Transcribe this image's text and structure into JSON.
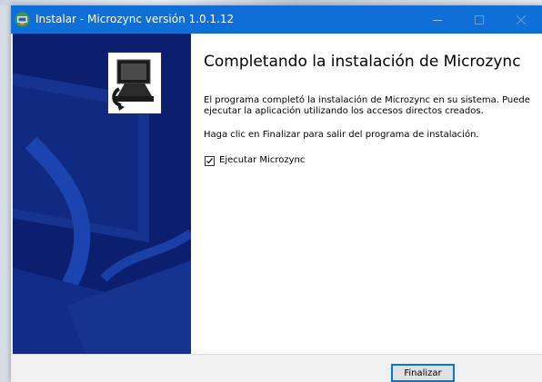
{
  "window": {
    "title": "Instalar - Microzync versión 1.0.1.12"
  },
  "titlebar": {
    "icons": [
      "installer-app-icon",
      "minimize-icon",
      "maximize-icon",
      "close-icon"
    ]
  },
  "wizard": {
    "heading": "Completando la instalación de Microzync",
    "paragraph_1": "El programa completó la instalación de Microzync en su sistema. Puede ejecutar la aplicación utilizando los accesos directos creados.",
    "paragraph_2": "Haga clic en Finalizar para salir del programa de instalación.",
    "checkbox": {
      "label": "Ejecutar Microzync",
      "checked": true
    },
    "side_panel_color": "#0c1f6e"
  },
  "footer": {
    "finish_label": "Finalizar"
  },
  "colors": {
    "titlebar": "#0f6fd6",
    "accent": "#0078d7"
  }
}
